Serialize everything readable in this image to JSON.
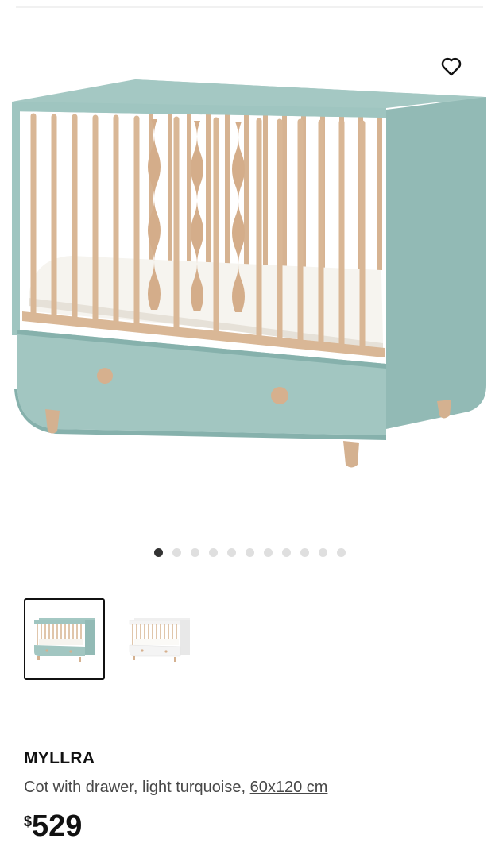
{
  "gallery": {
    "dot_count": 11,
    "active_index": 0,
    "thumbnails": [
      {
        "variant": "light turquoise",
        "selected": true
      },
      {
        "variant": "white",
        "selected": false
      }
    ]
  },
  "product": {
    "name": "MYLLRA",
    "description": "Cot with drawer, light turquoise, ",
    "size": "60x120 cm",
    "currency_symbol": "$",
    "price": "529"
  },
  "icons": {
    "favorite": "heart-outline-icon"
  },
  "colors": {
    "turquoise": "#9fc5c0",
    "turquoise_dark": "#86b1ac",
    "wood": "#d9b796",
    "mattress": "#f6f4ef",
    "text": "#111111",
    "muted_text": "#484848",
    "dot_active": "#333333",
    "dot_inactive": "#dfdfdf"
  }
}
